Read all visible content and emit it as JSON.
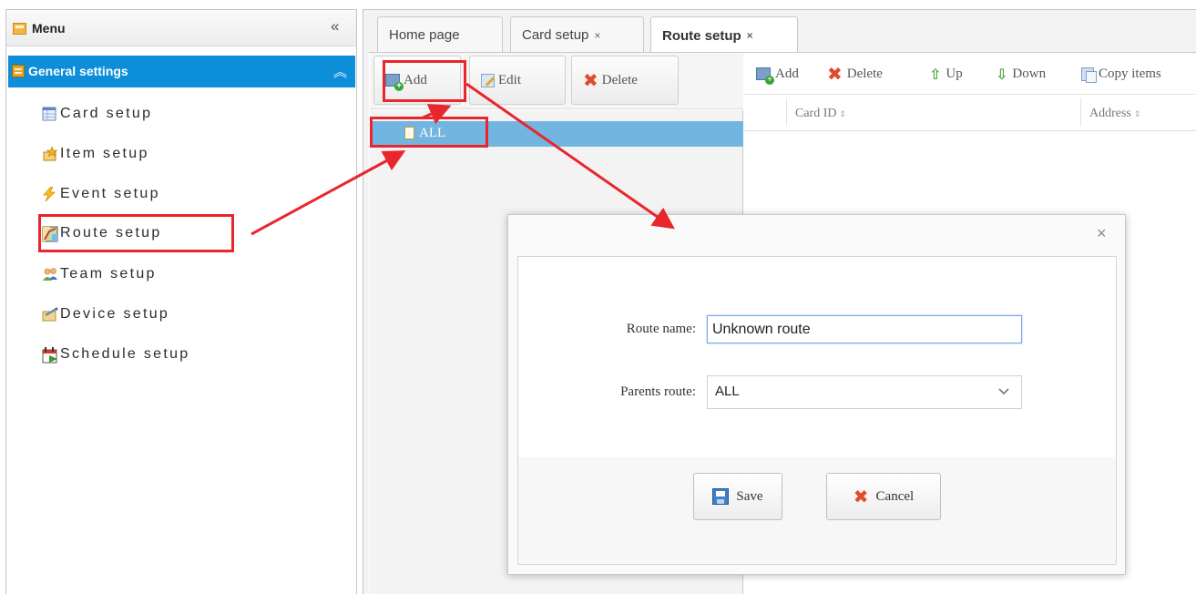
{
  "menu": {
    "title": "Menu",
    "collapse_glyph": "«",
    "group": {
      "title": "General settings",
      "collapse_glyph": "︽"
    },
    "items": [
      {
        "label": "Card setup",
        "icon": "table-icon"
      },
      {
        "label": "Item setup",
        "icon": "item-star-icon"
      },
      {
        "label": "Event setup",
        "icon": "lightning-icon"
      },
      {
        "label": "Route setup",
        "icon": "route-map-icon"
      },
      {
        "label": "Team setup",
        "icon": "team-icon"
      },
      {
        "label": "Device setup",
        "icon": "device-icon"
      },
      {
        "label": "Schedule setup",
        "icon": "calendar-icon"
      }
    ]
  },
  "tabs": [
    {
      "label": "Home page",
      "closable": false
    },
    {
      "label": "Card setup",
      "closable": true
    },
    {
      "label": "Route setup",
      "closable": true,
      "active": true
    }
  ],
  "tab_close_glyph": "×",
  "tree_toolbar": {
    "add": "Add",
    "edit": "Edit",
    "delete": "Delete"
  },
  "tree": {
    "root": "ALL"
  },
  "grid_toolbar": {
    "add": "Add",
    "delete": "Delete",
    "up": "Up",
    "down": "Down",
    "copy": "Copy items"
  },
  "grid_columns": [
    "Card ID",
    "Address"
  ],
  "sort_glyph": "⇕",
  "dialog": {
    "close_glyph": "×",
    "route_name_label": "Route name:",
    "route_name_value": "Unknown route",
    "parent_route_label": "Parents route:",
    "parent_route_value": "ALL",
    "save": "Save",
    "cancel": "Cancel"
  },
  "colors": {
    "accent": "#0c8ed9",
    "selection": "#72b5e0",
    "annotation": "#e8262c"
  }
}
